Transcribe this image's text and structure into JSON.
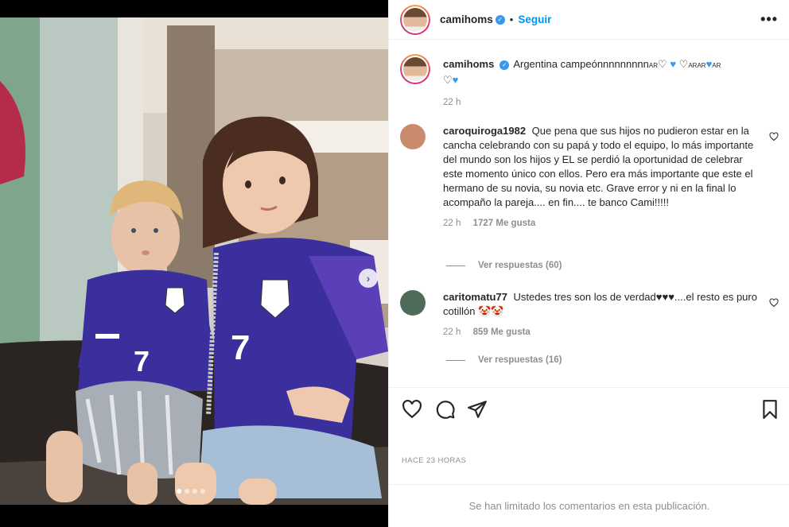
{
  "post": {
    "author": "camihoms",
    "follow_label": "Seguir",
    "separator": "•",
    "more_label": "•••",
    "caption_text": "Argentina campeónnnnnnnnn",
    "caption_time": "22 h",
    "time_ago": "HACE 23 HORAS",
    "comments_limited": "Se han limitado los comentarios en esta publicación.",
    "carousel": {
      "slides": 4,
      "active_index": 0
    },
    "next_label": "›"
  },
  "caption_tokens": {
    "ar1": "AR",
    "ar2": "AR",
    "ar3": "AR",
    "ar4": "AR",
    "heart_white": "♡",
    "heart_blue": "♥"
  },
  "comments": [
    {
      "username": "caroquiroga1982",
      "text": "Que pena que sus hijos no pudieron estar en la cancha celebrando con su papá y todo el equipo, lo más importante del mundo son los hijos y EL se perdió la oportunidad de celebrar este momento único con ellos. Pero era más importante que este el hermano de su novia, su novia etc. Grave error y ni en la final lo acompaño la pareja.... en fin.... te banco Cami!!!!!",
      "time": "22 h",
      "likes": "1727 Me gusta",
      "replies": "Ver respuestas (60)"
    },
    {
      "username": "caritomatu77",
      "text": "Ustedes tres son los de verdad♥♥♥....el resto es puro cotillón 🤡🤡",
      "time": "22 h",
      "likes": "859 Me gusta",
      "replies": "Ver respuestas (16)"
    }
  ],
  "colors": {
    "accent_blue": "#0095f6",
    "verified_blue": "#3897f0",
    "muted_text": "#8e8e8e",
    "text": "#262626",
    "jersey_purple": "#3b2f9e"
  },
  "icons": [
    "heart-icon",
    "comment-icon",
    "share-icon",
    "bookmark-icon",
    "verified-icon",
    "more-icon",
    "chevron-right-icon"
  ]
}
